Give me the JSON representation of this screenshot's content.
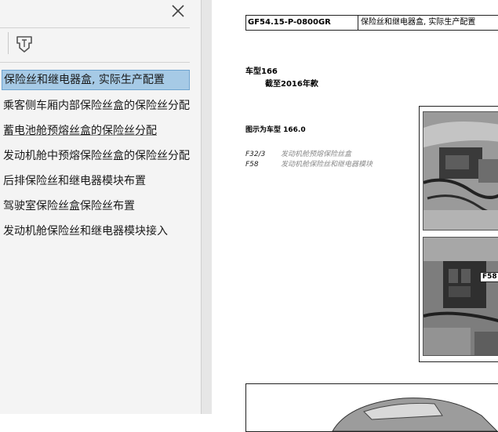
{
  "sidebar": {
    "items": [
      {
        "label": "保险丝和继电器盒, 实际生产配置"
      },
      {
        "label": "乘客侧车厢内部保险丝盒的保险丝分配"
      },
      {
        "label": "蓄电池舱预熔丝盒的保险丝分配"
      },
      {
        "label": "发动机舱中预熔保险丝盒的保险丝分配"
      },
      {
        "label": "后排保险丝和继电器模块布置"
      },
      {
        "label": "驾驶室保险丝盒保险丝布置"
      },
      {
        "label": "发动机舱保险丝和继电器模块接入"
      }
    ],
    "icons": {
      "close": "close-icon",
      "bookmark_tool": "bookmark-options-icon",
      "collapse": "collapse-left-icon"
    }
  },
  "document": {
    "code": "GF54.15-P-0800GR",
    "title": "保险丝和继电器盒, 实际生产配置",
    "model_line": "车型166",
    "model_sub": "截至2016年款",
    "figure_caption": "图示为车型 166.0",
    "legend": [
      {
        "code": "F32/3",
        "desc": "发动机舱预熔保险丝盒"
      },
      {
        "code": "F58",
        "desc": "发动机舱保险丝和继电器模块"
      }
    ],
    "photo_label": "F58"
  },
  "colors": {
    "selected_bg": "#a6cae6",
    "pane_bg": "#f4f4f4",
    "page_bg": "#ffffff"
  }
}
